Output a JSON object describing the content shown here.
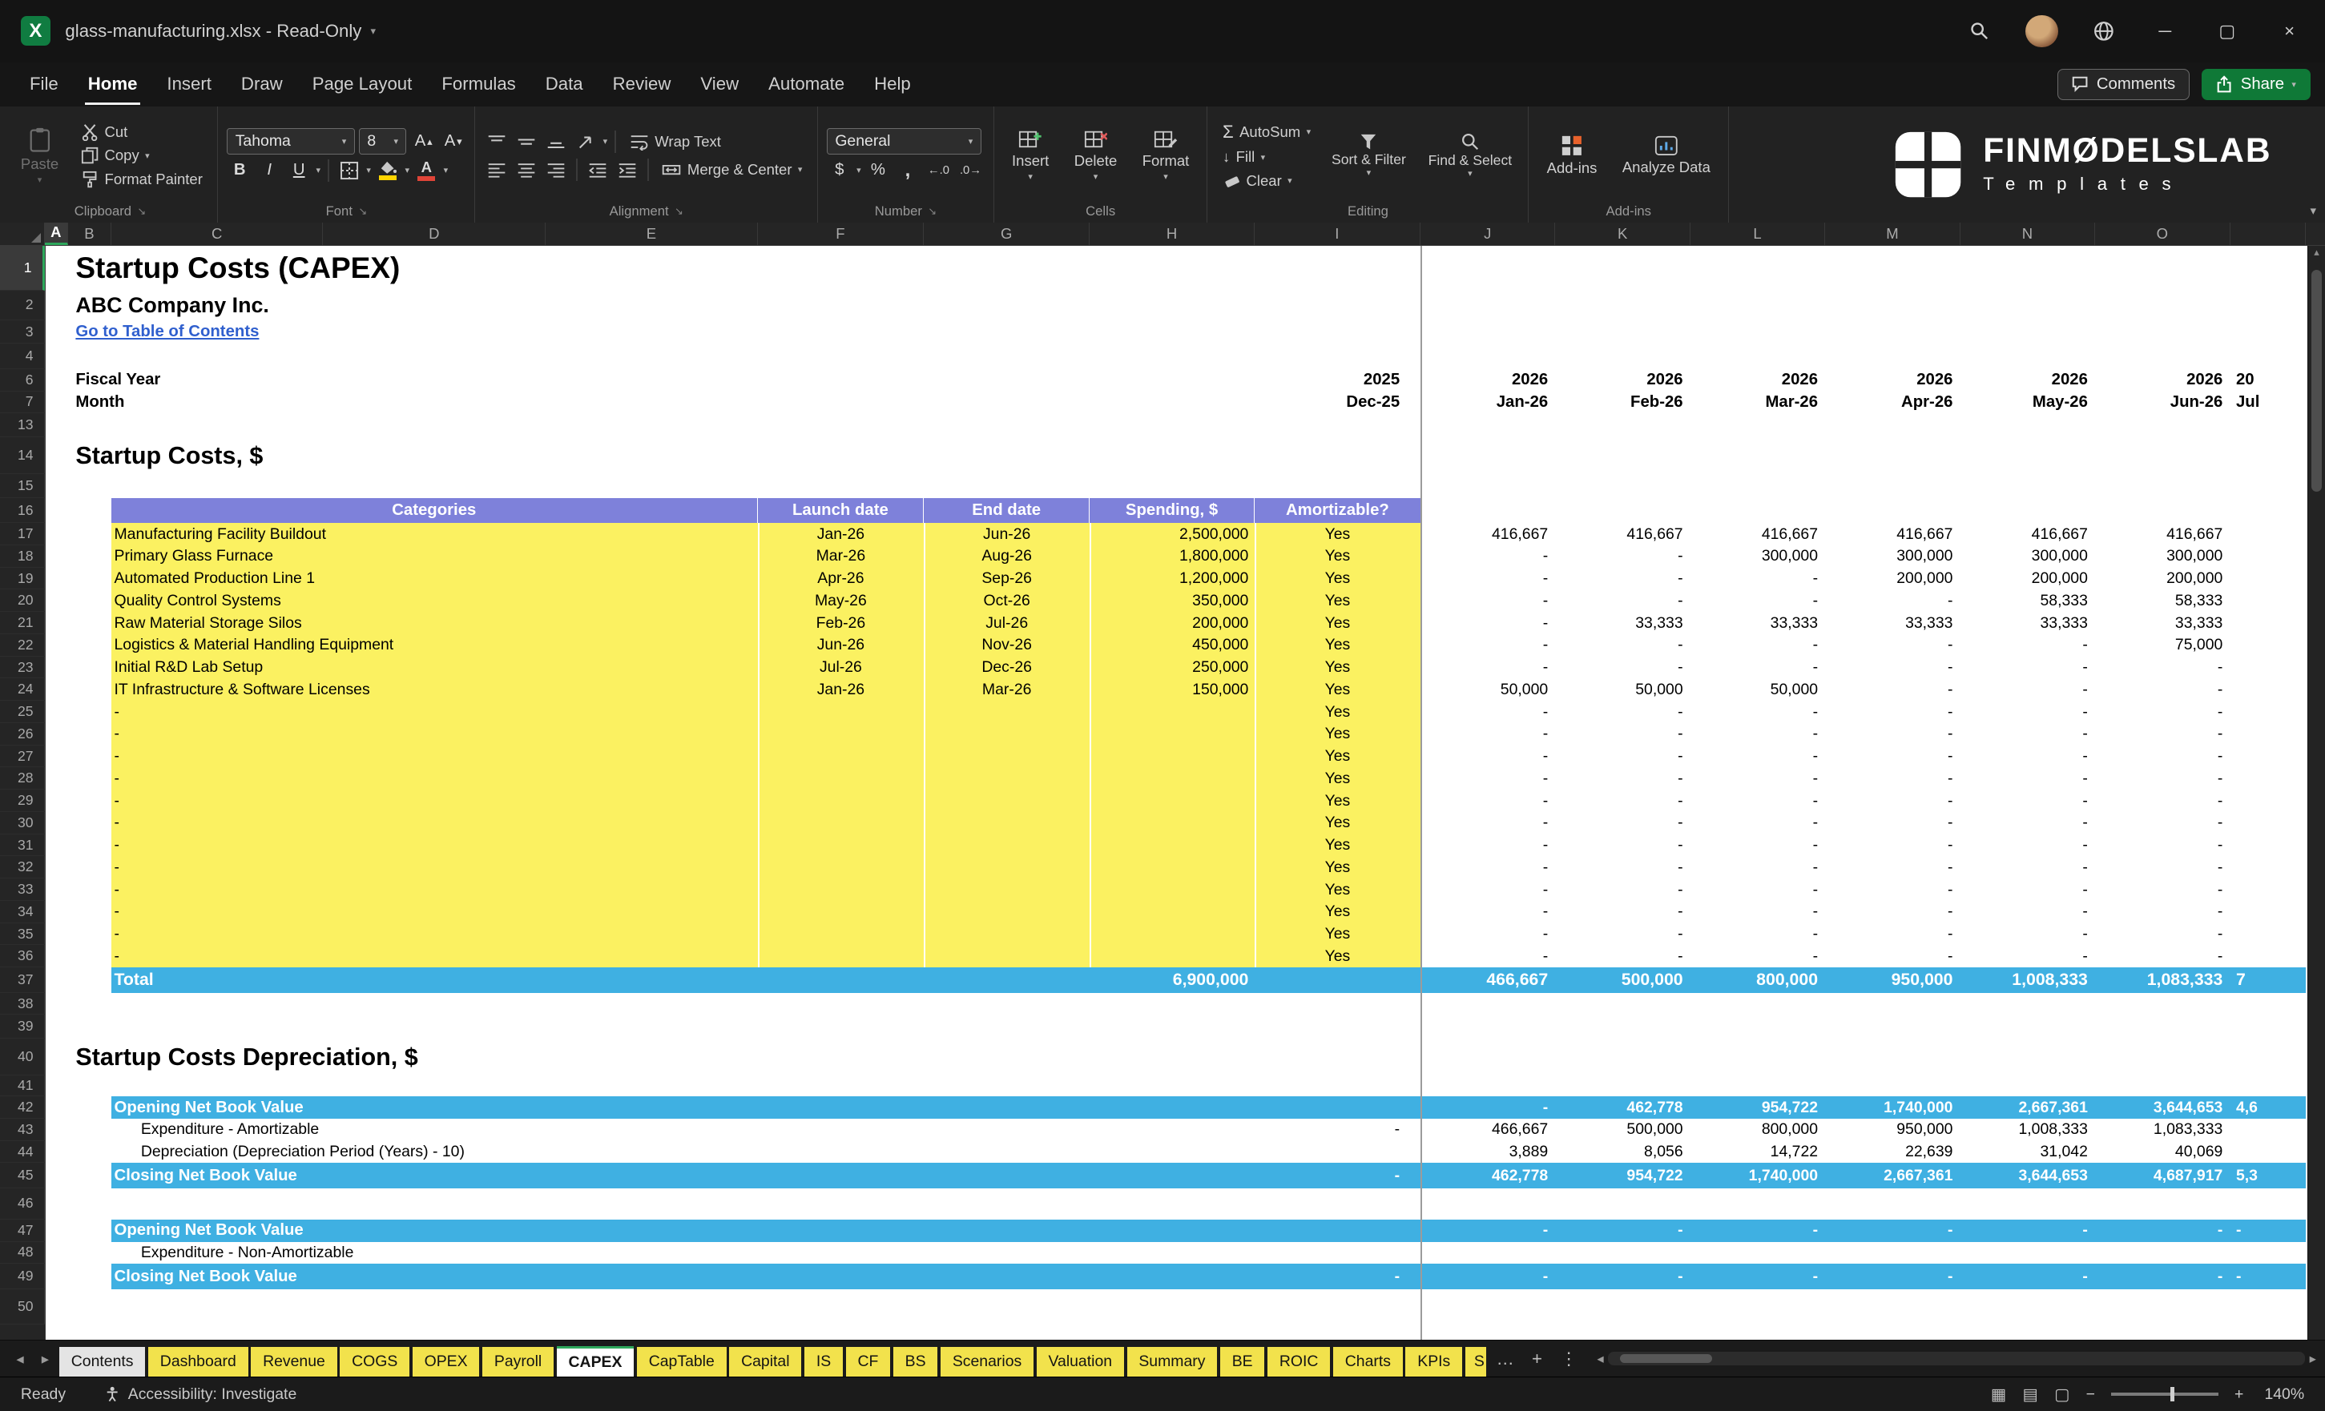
{
  "titlebar": {
    "title": "glass-manufacturing.xlsx - Read-Only"
  },
  "menubar": {
    "items": [
      "File",
      "Home",
      "Insert",
      "Draw",
      "Page Layout",
      "Formulas",
      "Data",
      "Review",
      "View",
      "Automate",
      "Help"
    ],
    "active_item": "Home",
    "comments_label": "Comments",
    "share_label": "Share"
  },
  "ribbon": {
    "clipboard": {
      "label": "Clipboard",
      "paste": "Paste",
      "cut": "Cut",
      "copy": "Copy",
      "format_painter": "Format Painter"
    },
    "font": {
      "label": "Font",
      "font_name": "Tahoma",
      "font_size": "8",
      "bold": "B",
      "italic": "I",
      "underline": "U"
    },
    "alignment": {
      "label": "Alignment",
      "wrap_text": "Wrap Text",
      "merge_center": "Merge & Center"
    },
    "number": {
      "label": "Number",
      "format": "General",
      "currency": "$",
      "percent": "%",
      "comma": ","
    },
    "cells": {
      "label": "Cells",
      "insert": "Insert",
      "delete": "Delete",
      "format": "Format"
    },
    "editing": {
      "label": "Editing",
      "autosum": "AutoSum",
      "fill": "Fill",
      "clear": "Clear",
      "sort_filter": "Sort & Filter",
      "find_select": "Find & Select"
    },
    "addins": {
      "label": "Add-ins",
      "addins_label": "Add-ins",
      "analyze_label": "Analyze Data"
    },
    "logo": {
      "title": "FINMØDELSLAB",
      "subtitle": "Templates"
    }
  },
  "grid": {
    "columns": [
      "A",
      "B",
      "C",
      "D",
      "E",
      "F",
      "G",
      "H",
      "I",
      "J",
      "K",
      "L",
      "M",
      "N",
      "O"
    ],
    "selected_column": "A",
    "selected_row": "1"
  },
  "sheet": {
    "title": "Startup Costs (CAPEX)",
    "company": "ABC Company Inc.",
    "toc_link": "Go to Table of Contents",
    "fiscal_year_label": "Fiscal Year",
    "fiscal_year_dec": "2025",
    "fiscal_years": [
      "2026",
      "2026",
      "2026",
      "2026",
      "2026",
      "2026"
    ],
    "fiscal_year_partial": "20",
    "month_label": "Month",
    "month_dec": "Dec-25",
    "months": [
      "Jan-26",
      "Feb-26",
      "Mar-26",
      "Apr-26",
      "May-26",
      "Jun-26"
    ],
    "month_partial": "Jul",
    "section1_title": "Startup Costs, $",
    "table_headers": {
      "categories": "Categories",
      "launch": "Launch date",
      "end": "End date",
      "spending": "Spending, $",
      "amortizable": "Amortizable?"
    },
    "capex_rows": [
      {
        "row": "17",
        "category": "Manufacturing Facility Buildout",
        "launch": "Jan-26",
        "end": "Jun-26",
        "spending": "2,500,000",
        "amortizable": "Yes",
        "values": [
          "416,667",
          "416,667",
          "416,667",
          "416,667",
          "416,667",
          "416,667"
        ]
      },
      {
        "row": "18",
        "category": "Primary Glass Furnace",
        "launch": "Mar-26",
        "end": "Aug-26",
        "spending": "1,800,000",
        "amortizable": "Yes",
        "values": [
          "-",
          "-",
          "300,000",
          "300,000",
          "300,000",
          "300,000"
        ]
      },
      {
        "row": "19",
        "category": "Automated Production Line 1",
        "launch": "Apr-26",
        "end": "Sep-26",
        "spending": "1,200,000",
        "amortizable": "Yes",
        "values": [
          "-",
          "-",
          "-",
          "200,000",
          "200,000",
          "200,000"
        ]
      },
      {
        "row": "20",
        "category": "Quality Control Systems",
        "launch": "May-26",
        "end": "Oct-26",
        "spending": "350,000",
        "amortizable": "Yes",
        "values": [
          "-",
          "-",
          "-",
          "-",
          "58,333",
          "58,333"
        ]
      },
      {
        "row": "21",
        "category": "Raw Material Storage Silos",
        "launch": "Feb-26",
        "end": "Jul-26",
        "spending": "200,000",
        "amortizable": "Yes",
        "values": [
          "-",
          "33,333",
          "33,333",
          "33,333",
          "33,333",
          "33,333"
        ]
      },
      {
        "row": "22",
        "category": "Logistics & Material Handling Equipment",
        "launch": "Jun-26",
        "end": "Nov-26",
        "spending": "450,000",
        "amortizable": "Yes",
        "values": [
          "-",
          "-",
          "-",
          "-",
          "-",
          "75,000"
        ]
      },
      {
        "row": "23",
        "category": "Initial R&D Lab Setup",
        "launch": "Jul-26",
        "end": "Dec-26",
        "spending": "250,000",
        "amortizable": "Yes",
        "values": [
          "-",
          "-",
          "-",
          "-",
          "-",
          "-"
        ]
      },
      {
        "row": "24",
        "category": "IT Infrastructure & Software Licenses",
        "launch": "Jan-26",
        "end": "Mar-26",
        "spending": "150,000",
        "amortizable": "Yes",
        "values": [
          "50,000",
          "50,000",
          "50,000",
          "-",
          "-",
          "-"
        ]
      }
    ],
    "empty_capex_rows": [
      "25",
      "26",
      "27",
      "28",
      "29",
      "30",
      "31",
      "32",
      "33",
      "34",
      "35",
      "36"
    ],
    "empty_row_placeholder": "-",
    "empty_row_amortizable": "Yes",
    "total_row": {
      "row": "37",
      "label": "Total",
      "spending": "6,900,000",
      "values": [
        "466,667",
        "500,000",
        "800,000",
        "950,000",
        "1,008,333",
        "1,083,333"
      ],
      "partial_next": "7"
    },
    "section2_title": "Startup Costs Depreciation, $",
    "dep_rows": [
      {
        "row": "42",
        "label": "Opening Net Book Value",
        "style": "blue",
        "dec": "",
        "values": [
          "-",
          "462,778",
          "954,722",
          "1,740,000",
          "2,667,361",
          "3,644,653"
        ],
        "partial_next": "4,6"
      },
      {
        "row": "43",
        "label": "Expenditure - Amortizable",
        "style": "plain",
        "dec": "-",
        "values": [
          "466,667",
          "500,000",
          "800,000",
          "950,000",
          "1,008,333",
          "1,083,333"
        ],
        "partial_next": ""
      },
      {
        "row": "44",
        "label": "Depreciation (Depreciation Period (Years) - 10)",
        "style": "plain",
        "dec": "",
        "values": [
          "3,889",
          "8,056",
          "14,722",
          "22,639",
          "31,042",
          "40,069"
        ],
        "partial_next": ""
      },
      {
        "row": "45",
        "label": "Closing Net Book Value",
        "style": "blue",
        "dec": "-",
        "values": [
          "462,778",
          "954,722",
          "1,740,000",
          "2,667,361",
          "3,644,653",
          "4,687,917"
        ],
        "partial_next": "5,3"
      },
      {
        "row": "47",
        "label": "Opening Net Book Value",
        "style": "blue",
        "dec": "",
        "values": [
          "-",
          "-",
          "-",
          "-",
          "-",
          "-"
        ],
        "partial_next": "-"
      },
      {
        "row": "48",
        "label": "Expenditure - Non-Amortizable",
        "style": "plain",
        "dec": "",
        "values": [
          "",
          "",
          "",
          "",
          "",
          ""
        ],
        "partial_next": ""
      },
      {
        "row": "49",
        "label": "Closing Net Book Value",
        "style": "blue",
        "dec": "-",
        "values": [
          "-",
          "-",
          "-",
          "-",
          "-",
          "-"
        ],
        "partial_next": "-"
      }
    ]
  },
  "tabs": {
    "items": [
      {
        "label": "Contents",
        "color": "light"
      },
      {
        "label": "Dashboard"
      },
      {
        "label": "Revenue"
      },
      {
        "label": "COGS"
      },
      {
        "label": "OPEX"
      },
      {
        "label": "Payroll"
      },
      {
        "label": "CAPEX",
        "active": true
      },
      {
        "label": "CapTable"
      },
      {
        "label": "Capital"
      },
      {
        "label": "IS"
      },
      {
        "label": "CF"
      },
      {
        "label": "BS"
      },
      {
        "label": "Scenarios"
      },
      {
        "label": "Valuation"
      },
      {
        "label": "Summary"
      },
      {
        "label": "BE"
      },
      {
        "label": "ROIC"
      },
      {
        "label": "Charts"
      },
      {
        "label": "KPIs"
      },
      {
        "label": "S",
        "clipped": true
      }
    ]
  },
  "statusbar": {
    "ready": "Ready",
    "accessibility": "Accessibility: Investigate",
    "zoom": "140%"
  },
  "colors": {
    "input_yellow": "#FBF161",
    "header_purple": "#7E81DA",
    "total_blue": "#3FB0E2",
    "excel_green": "#107C41",
    "link_blue": "#2F5FCE"
  }
}
